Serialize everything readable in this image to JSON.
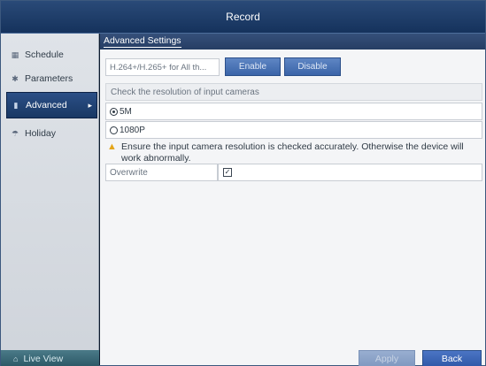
{
  "window": {
    "title": "Record"
  },
  "sidebar": {
    "items": [
      {
        "label": "Schedule",
        "icon": "calendar-icon"
      },
      {
        "label": "Parameters",
        "icon": "gear-icon"
      },
      {
        "label": "Advanced",
        "icon": "advanced-icon",
        "active": true
      },
      {
        "label": "Holiday",
        "icon": "holiday-icon"
      }
    ],
    "live_view": "Live View"
  },
  "main": {
    "tab": "Advanced Settings",
    "codec": {
      "field": "H.264+/H.265+ for All th...",
      "enable": "Enable",
      "disable": "Disable"
    },
    "resolution_hint": "Check the resolution of input cameras",
    "options": [
      {
        "label": "5M",
        "selected": true
      },
      {
        "label": "1080P",
        "selected": false
      }
    ],
    "warning": "Ensure the input camera resolution is checked accurately. Otherwise the device will work abnormally.",
    "overwrite": {
      "label": "Overwrite",
      "checked": true
    }
  },
  "footer": {
    "apply": "Apply",
    "back": "Back"
  },
  "colors": {
    "accent": "#2f58a8",
    "warning": "#e4a51a",
    "sidebar_active": "#193864"
  }
}
